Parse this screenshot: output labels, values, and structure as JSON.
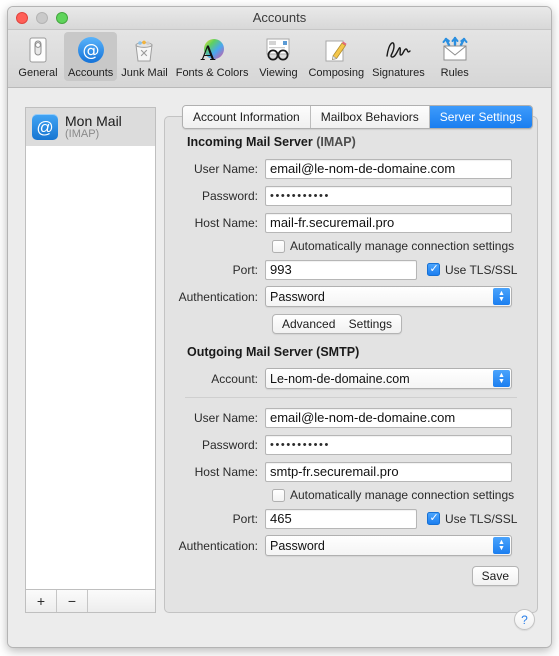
{
  "window": {
    "title": "Accounts"
  },
  "toolbar": {
    "items": [
      {
        "label": "General",
        "icon": "general-icon"
      },
      {
        "label": "Accounts",
        "icon": "accounts-at-icon"
      },
      {
        "label": "Junk Mail",
        "icon": "junk-mail-trash-icon"
      },
      {
        "label": "Fonts & Colors",
        "icon": "fonts-colors-icon"
      },
      {
        "label": "Viewing",
        "icon": "viewing-glasses-icon"
      },
      {
        "label": "Composing",
        "icon": "composing-pencil-icon"
      },
      {
        "label": "Signatures",
        "icon": "signature-icon"
      },
      {
        "label": "Rules",
        "icon": "rules-envelope-icon"
      }
    ]
  },
  "account_list": {
    "accounts": [
      {
        "name": "Mon Mail",
        "type": "(IMAP)"
      }
    ],
    "add_label": "+",
    "remove_label": "−"
  },
  "tabs": [
    {
      "label": "Account Information",
      "active": false
    },
    {
      "label": "Mailbox Behaviors",
      "active": false
    },
    {
      "label": "Server Settings",
      "active": true
    }
  ],
  "incoming": {
    "heading_bold": "Incoming Mail Server",
    "heading_light": "(IMAP)",
    "username_label": "User Name:",
    "username_value": "email@le-nom-de-domaine.com",
    "password_label": "Password:",
    "password_value": "•••••••••••",
    "hostname_label": "Host Name:",
    "hostname_value": "mail-fr.securemail.pro",
    "auto_manage_label": "Automatically manage connection settings",
    "auto_manage_checked": false,
    "port_label": "Port:",
    "port_value": "993",
    "tls_label": "Use TLS/SSL",
    "tls_checked": true,
    "auth_label": "Authentication:",
    "auth_value": "Password",
    "advanced_label": "Advanced",
    "settings_label": "Settings"
  },
  "outgoing": {
    "heading": "Outgoing Mail Server (SMTP)",
    "account_label": "Account:",
    "account_value": "Le-nom-de-domaine.com",
    "username_label": "User Name:",
    "username_value": "email@le-nom-de-domaine.com",
    "password_label": "Password:",
    "password_value": "•••••••••••",
    "hostname_label": "Host Name:",
    "hostname_value": "smtp-fr.securemail.pro",
    "auto_manage_label": "Automatically manage connection settings",
    "auto_manage_checked": false,
    "port_label": "Port:",
    "port_value": "465",
    "tls_label": "Use TLS/SSL",
    "tls_checked": true,
    "auth_label": "Authentication:",
    "auth_value": "Password"
  },
  "save_label": "Save",
  "help_label": "?",
  "colors": {
    "accent_blue": "#1a7ef0",
    "window_bg": "#ececec",
    "panel_bg": "#e3e3e3"
  }
}
